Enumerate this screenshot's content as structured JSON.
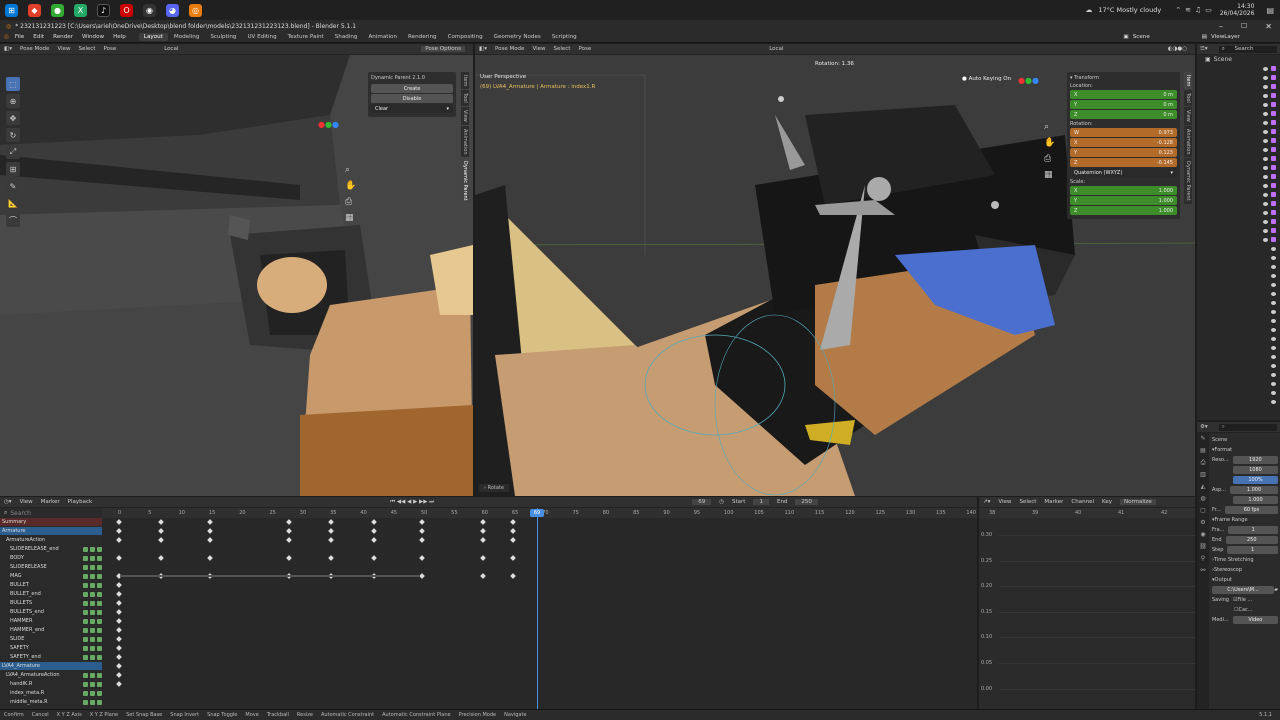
{
  "taskbar": {
    "weather": "17°C  Mostly cloudy",
    "time": "14:30",
    "date": "26/04/2026"
  },
  "window": {
    "title": "* 232131231223 [C:\\Users\\ariel\\OneDrive\\Desktop\\blend folder\\models\\232131231223123.blend] - Blender 5.1.1"
  },
  "menu": [
    "File",
    "Edit",
    "Render",
    "Window",
    "Help"
  ],
  "workspaces": [
    "Layout",
    "Modeling",
    "Sculpting",
    "UV Editing",
    "Texture Paint",
    "Shading",
    "Animation",
    "Rendering",
    "Compositing",
    "Geometry Nodes",
    "Scripting"
  ],
  "scene": "Scene",
  "viewlayer": "ViewLayer",
  "left_view": {
    "mode": "Pose Mode",
    "menus": [
      "View",
      "Select",
      "Pose"
    ],
    "orientation": "Local",
    "pose_options": "Pose Options"
  },
  "dynamic_parent": {
    "title": "Dynamic Parent 2.1.0",
    "create": "Create",
    "disable": "Disable",
    "clear": "Clear"
  },
  "left_vtabs": [
    "Item",
    "Tool",
    "View",
    "Animation",
    "Dynamic Parent"
  ],
  "right_view": {
    "mode": "Pose Mode",
    "menus": [
      "View",
      "Select",
      "Pose"
    ],
    "orientation": "Local",
    "rotation": "Rotation: 1.36",
    "perspective": "User Perspective",
    "object": "(69) LVA4_Armature | Armature : index1.R",
    "auto_keying": "Auto Keying On",
    "rotate_label": "Rotate"
  },
  "transform": {
    "title": "Transform",
    "location_label": "Location:",
    "rotation_label": "Rotation:",
    "scale_label": "Scale:",
    "mode": "Quaternion (WXYZ)",
    "location": [
      {
        "axis": "X",
        "val": "0 m"
      },
      {
        "axis": "Y",
        "val": "0 m"
      },
      {
        "axis": "Z",
        "val": "0 m"
      }
    ],
    "rotation": [
      {
        "axis": "W",
        "val": "0.973"
      },
      {
        "axis": "X",
        "val": "-0.128"
      },
      {
        "axis": "Y",
        "val": "0.123"
      },
      {
        "axis": "Z",
        "val": "-0.145"
      }
    ],
    "scale": [
      {
        "axis": "X",
        "val": "1.000"
      },
      {
        "axis": "Y",
        "val": "1.000"
      },
      {
        "axis": "Z",
        "val": "1.000"
      }
    ]
  },
  "right_vtabs": [
    "Item",
    "Tool",
    "View",
    "Animation",
    "Dynamic Parent"
  ],
  "dopesheet": {
    "menus": [
      "View",
      "Marker",
      "Playback"
    ],
    "current_frame": "69",
    "start_label": "Start",
    "start": "1",
    "end_label": "End",
    "end": "250",
    "search": "Search",
    "ticks": [
      "0",
      "5",
      "10",
      "15",
      "20",
      "25",
      "30",
      "35",
      "40",
      "45",
      "50",
      "55",
      "60",
      "65",
      "70",
      "75",
      "80",
      "85",
      "90",
      "95",
      "100",
      "105",
      "110",
      "115",
      "120",
      "125",
      "130",
      "135",
      "140"
    ],
    "channels": [
      "Summary",
      "Armature",
      "ArmatureAction",
      "SLIDERELEASE_end",
      "BODY",
      "SLIDERELEASE",
      "MAG",
      "BULLET",
      "BULLET_end",
      "BULLETS",
      "BULLETS_end",
      "HAMMER",
      "HAMMER_end",
      "SLIDE",
      "SAFETY",
      "SAFETY_end",
      "LVA4_Armature",
      "LVA4_ArmatureAction",
      "handIK.R",
      "index_meta.R",
      "middle_meta.R"
    ]
  },
  "graph": {
    "menus": [
      "View",
      "Select",
      "Marker",
      "Channel",
      "Key"
    ],
    "normalize": "Normalize",
    "ticks": [
      "38",
      "39",
      "40",
      "41",
      "42"
    ],
    "values": [
      "0.30",
      "0.25",
      "0.20",
      "0.15",
      "0.10",
      "0.05",
      "0.00"
    ]
  },
  "outliner": {
    "search": "Search",
    "scene": "Scene"
  },
  "properties": {
    "scene": "Scene",
    "format": "Format",
    "reso_label": "Reso...",
    "res_x": "1920",
    "res_y": "1080",
    "pct": "100%",
    "asp_label": "Asp...",
    "asp_x": "1.000",
    "asp_y": "1.000",
    "fr_label": "Fr...",
    "fps": "60 fps",
    "frame_range": "Frame Range",
    "fra_label": "Fra...",
    "start": "1",
    "end_label": "End",
    "end": "250",
    "step_label": "Step",
    "step": "1",
    "time_stretch": "Time Stretching",
    "stereo": "Stereoscop",
    "output": "Output",
    "path": "C:\\Users\\M...",
    "saving": "Saving",
    "file": "File ...",
    "cac": "Cac...",
    "medi": "Medi...",
    "video": "Video"
  },
  "status": [
    "Confirm",
    "Cancel",
    "X Y Z Axis",
    "X Y Z Plane",
    "Set Snap Base",
    "Snap Invert",
    "Snap Toggle",
    "Move",
    "Trackball",
    "Resize",
    "Automatic Constraint",
    "Automatic Constraint Plane",
    "Precision Mode",
    "Navigate"
  ],
  "version": "5.1.1"
}
